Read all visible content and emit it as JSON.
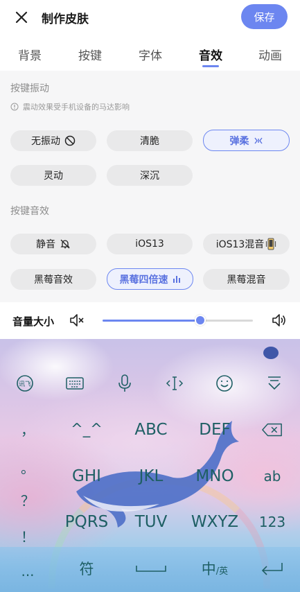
{
  "header": {
    "title": "制作皮肤",
    "save_label": "保存"
  },
  "tabs": [
    {
      "label": "背景"
    },
    {
      "label": "按键"
    },
    {
      "label": "字体"
    },
    {
      "label": "音效",
      "active": true
    },
    {
      "label": "动画"
    }
  ],
  "vibration": {
    "title": "按键振动",
    "hint": "震动效果受手机设备的马达影响",
    "options": [
      {
        "label": "无振动",
        "icon": "no-entry-icon"
      },
      {
        "label": "清脆"
      },
      {
        "label": "弹柔",
        "icon": "vibrate-icon",
        "selected": true
      },
      {
        "label": "灵动"
      },
      {
        "label": "深沉"
      }
    ]
  },
  "sound": {
    "title": "按键音效",
    "options": [
      {
        "label": "静音",
        "icon": "bell-off-icon"
      },
      {
        "label": "iOS13"
      },
      {
        "label": "iOS13混音",
        "icon": "phone-vibrate-icon"
      },
      {
        "label": "黑莓音效"
      },
      {
        "label": "黑莓四倍速",
        "icon": "bars-icon",
        "selected": true
      },
      {
        "label": "黑莓混音"
      }
    ]
  },
  "volume": {
    "label": "音量大小",
    "level_percent": 65
  },
  "keyboard": {
    "toolbar_icons": [
      "ifly-icon",
      "keyboard-icon",
      "microphone-icon",
      "cursor-move-icon",
      "emoji-icon",
      "collapse-keyboard-icon"
    ],
    "side_punct": [
      "，",
      "。",
      "？",
      "！",
      "..."
    ],
    "rows": [
      [
        "^_^",
        "ABC",
        "DEF"
      ],
      [
        "GHI",
        "JKL",
        "MNO"
      ],
      [
        "PQRS",
        "TUV",
        "WXYZ"
      ]
    ],
    "right_keys": {
      "backspace_icon": "backspace-icon",
      "ab": "ab",
      "num": "123"
    },
    "bottom": {
      "symbol": "符",
      "space_icon": "space-bar-icon",
      "lang_main": "中",
      "lang_sub": "/英",
      "enter_icon": "enter-icon"
    }
  },
  "colors": {
    "accent": "#6c86f0",
    "key_text": "#1e5f64",
    "panel_bg": "#f6f6f7"
  }
}
